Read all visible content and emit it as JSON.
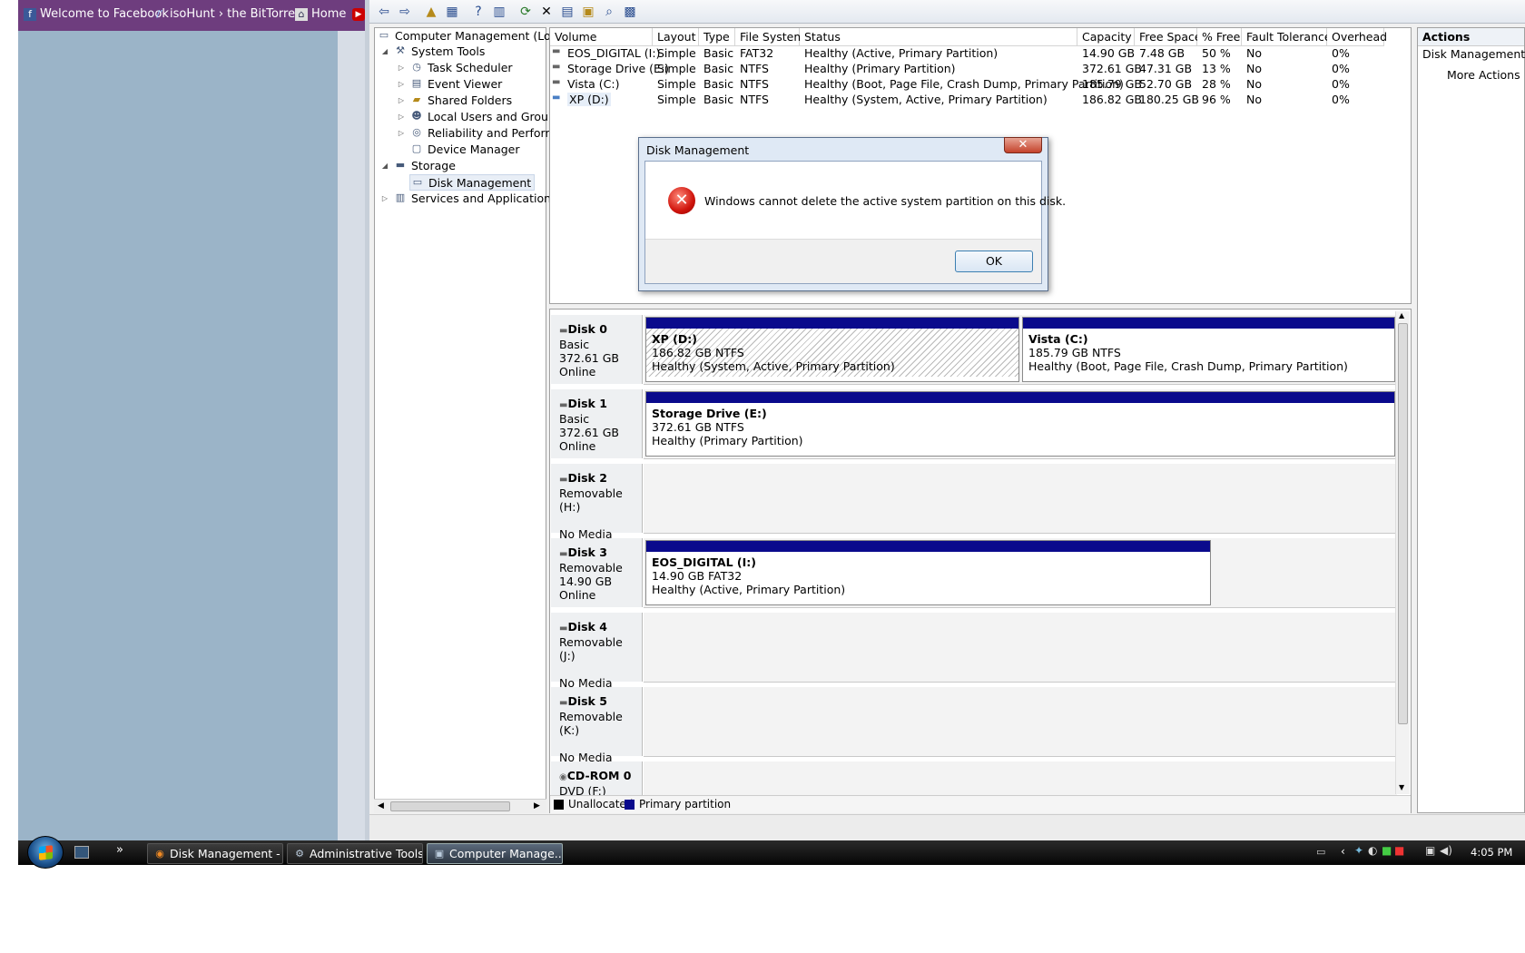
{
  "browser_bar": {
    "bookmarks": [
      {
        "label": "Welcome to Facebook",
        "icon": "facebook-icon"
      },
      {
        "label": "isoHunt › the BitTorre...",
        "icon": "isohunt-icon"
      },
      {
        "label": "Home",
        "icon": "home-icon"
      }
    ]
  },
  "tree": {
    "root": "Computer Management (Local",
    "system_tools": "System Tools",
    "task_scheduler": "Task Scheduler",
    "event_viewer": "Event Viewer",
    "shared_folders": "Shared Folders",
    "local_users": "Local Users and Groups",
    "reliability": "Reliability and Performa",
    "device_manager": "Device Manager",
    "storage": "Storage",
    "disk_management": "Disk Management",
    "services": "Services and Applications"
  },
  "volumes": {
    "headers": [
      "Volume",
      "Layout",
      "Type",
      "File System",
      "Status",
      "Capacity",
      "Free Space",
      "% Free",
      "Fault Tolerance",
      "Overhead"
    ],
    "rows": [
      [
        "EOS_DIGITAL (I:)",
        "Simple",
        "Basic",
        "FAT32",
        "Healthy (Active, Primary Partition)",
        "14.90 GB",
        "7.48 GB",
        "50 %",
        "No",
        "0%"
      ],
      [
        "Storage Drive (E:)",
        "Simple",
        "Basic",
        "NTFS",
        "Healthy (Primary Partition)",
        "372.61 GB",
        "47.31 GB",
        "13 %",
        "No",
        "0%"
      ],
      [
        "Vista (C:)",
        "Simple",
        "Basic",
        "NTFS",
        "Healthy (Boot, Page File, Crash Dump, Primary Partition)",
        "185.79 GB",
        "52.70 GB",
        "28 %",
        "No",
        "0%"
      ],
      [
        "XP (D:)",
        "Simple",
        "Basic",
        "NTFS",
        "Healthy (System, Active, Primary Partition)",
        "186.82 GB",
        "180.25 GB",
        "96 %",
        "No",
        "0%"
      ]
    ]
  },
  "disks": {
    "disk0": {
      "name": "Disk 0",
      "type": "Basic",
      "size": "372.61 GB",
      "state": "Online"
    },
    "disk1": {
      "name": "Disk 1",
      "type": "Basic",
      "size": "372.61 GB",
      "state": "Online"
    },
    "disk2": {
      "name": "Disk 2",
      "type": "Removable (H:)",
      "state": "No Media"
    },
    "disk3": {
      "name": "Disk 3",
      "type": "Removable",
      "size": "14.90 GB",
      "state": "Online"
    },
    "disk4": {
      "name": "Disk 4",
      "type": "Removable (J:)",
      "state": "No Media"
    },
    "disk5": {
      "name": "Disk 5",
      "type": "Removable (K:)",
      "state": "No Media"
    },
    "cdrom0": {
      "name": "CD-ROM 0",
      "type": "DVD (F:)"
    }
  },
  "partitions": {
    "xp": {
      "name": "XP (D:)",
      "size": "186.82 GB NTFS",
      "status": "Healthy (System, Active, Primary Partition)"
    },
    "vista": {
      "name": "Vista (C:)",
      "size": "185.79 GB NTFS",
      "status": "Healthy (Boot, Page File, Crash Dump, Primary Partition)"
    },
    "storage": {
      "name": "Storage Drive (E:)",
      "size": "372.61 GB NTFS",
      "status": "Healthy (Primary Partition)"
    },
    "eos": {
      "name": "EOS_DIGITAL (I:)",
      "size": "14.90 GB FAT32",
      "status": "Healthy (Active, Primary Partition)"
    }
  },
  "legend": {
    "unallocated": "Unallocated",
    "primary": "Primary partition"
  },
  "actions": {
    "header": "Actions",
    "section": "Disk Management",
    "more": "More Actions"
  },
  "dialog": {
    "title": "Disk Management",
    "message": "Windows cannot delete the active system partition on this disk.",
    "ok": "OK",
    "close": "✕"
  },
  "taskbar": {
    "tasks": [
      "Disk Management - ...",
      "Administrative Tools",
      "Computer Manage..."
    ],
    "clock": "4:05 PM"
  },
  "colors": {
    "primary_partition": "#0a0a8c",
    "unallocated": "#000000"
  }
}
